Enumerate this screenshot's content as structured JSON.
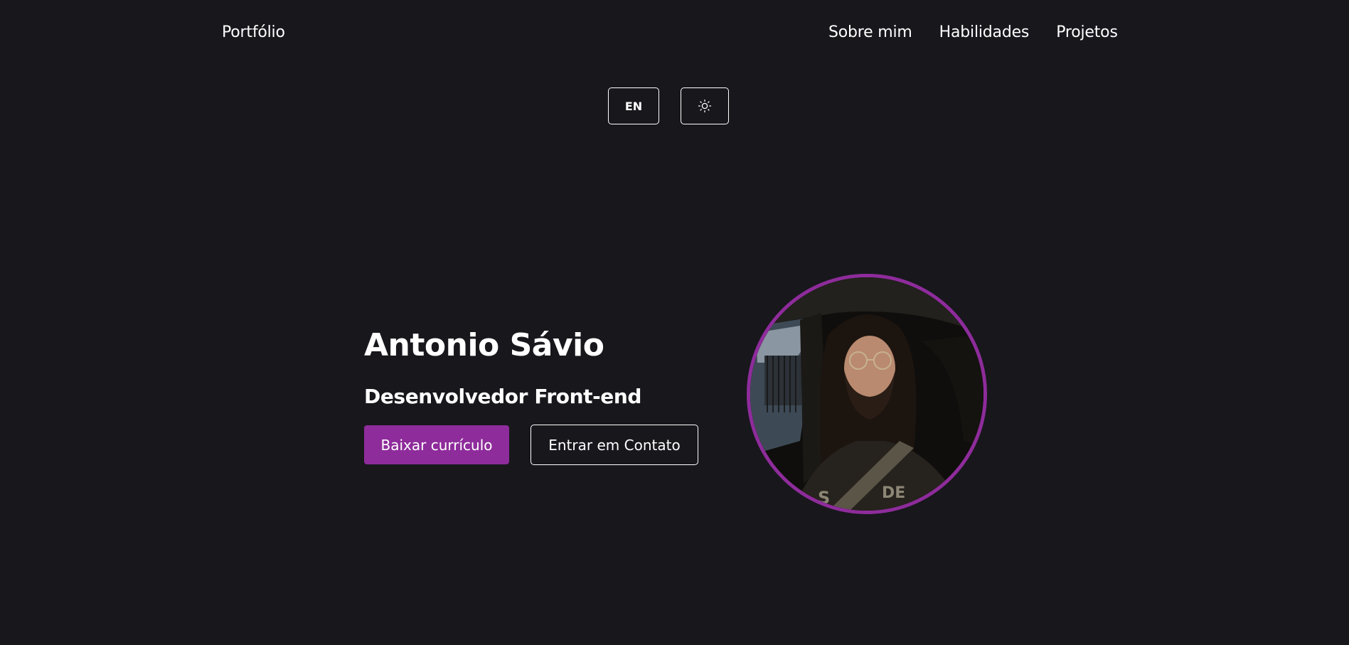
{
  "header": {
    "brand": "Portfólio",
    "nav": [
      {
        "label": "Sobre mim"
      },
      {
        "label": "Habilidades"
      },
      {
        "label": "Projetos"
      }
    ]
  },
  "controls": {
    "language_label": "EN",
    "theme_icon": "sun-icon"
  },
  "hero": {
    "name": "Antonio Sávio",
    "role": "Desenvolvedor Front-end",
    "download_button": "Baixar currículo",
    "contact_button": "Entrar em Contato"
  },
  "colors": {
    "background": "#18171c",
    "accent": "#8e2c9b",
    "text": "#ffffff"
  }
}
